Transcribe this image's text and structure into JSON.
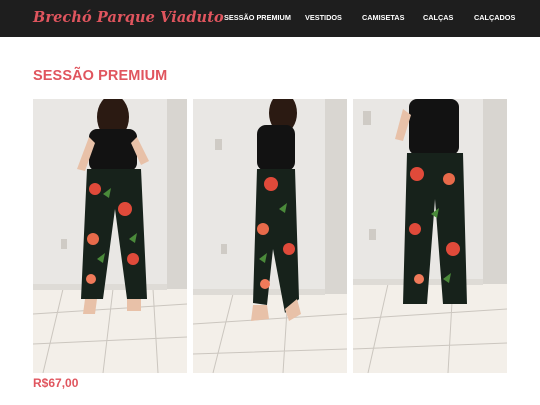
{
  "brand": {
    "name": "Brechó Parque Viaduto"
  },
  "nav": {
    "items": [
      "SESSÃO PREMIUM",
      "VESTIDOS",
      "CAMISETAS",
      "CALÇAS",
      "CALÇADOS"
    ]
  },
  "section": {
    "title": "SESSÃO PREMIUM"
  },
  "product": {
    "price": "R$67,00",
    "photos": [
      "front-view",
      "side-view",
      "back-view"
    ]
  },
  "colors": {
    "accent": "#e0555e",
    "navbar_bg": "#1e1e1e",
    "nav_text": "#ffffff",
    "wall": "#e9e7e4",
    "floor": "#f3efe9",
    "top": "#121212",
    "pants": "#17221b",
    "skin": "#e8c1a8",
    "hair": "#2b1a12"
  }
}
